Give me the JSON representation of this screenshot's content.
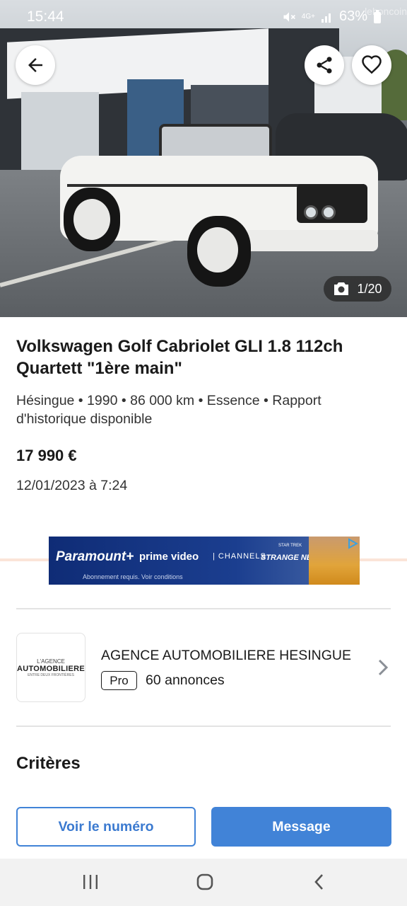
{
  "status_bar": {
    "time": "15:44",
    "network": "4G+",
    "battery": "63%",
    "icons": [
      "mute-icon",
      "signal-icon",
      "battery-icon"
    ]
  },
  "photo": {
    "counter": "1/20",
    "watermark": "leboncoin",
    "icons": [
      "back-arrow-icon",
      "share-icon",
      "heart-icon",
      "camera-icon"
    ]
  },
  "listing": {
    "title": "Volkswagen Golf Cabriolet GLI 1.8 112ch Quartett \"1ère main\"",
    "meta": "Hésingue • 1990 • 86 000 km • Essence • Rapport d'historique disponible",
    "price": "17 990 €",
    "date": "12/01/2023 à 7:24"
  },
  "ad": {
    "brand1": "Paramount+",
    "brand2": "prime video",
    "channels": "| CHANNELS",
    "show": "STRANGE NEW WORLDS",
    "star_trek": "STAR TREK",
    "fine_print": "Abonnement requis. Voir conditions"
  },
  "seller": {
    "logo_line1": "L'AGENCE",
    "logo_line2": "AUTOMOBILIERE",
    "logo_line3": "ENTRE DEUX FRONTIÈRES",
    "name": "AGENCE AUTOMOBILIERE HESINGUE",
    "badge": "Pro",
    "annonces": "60 annonces"
  },
  "section": {
    "criteres": "Critères"
  },
  "actions": {
    "voir_numero": "Voir le numéro",
    "message": "Message"
  },
  "colors": {
    "primary": "#4183d7",
    "text": "#1a1a1a",
    "divider": "#e3e3e3"
  }
}
